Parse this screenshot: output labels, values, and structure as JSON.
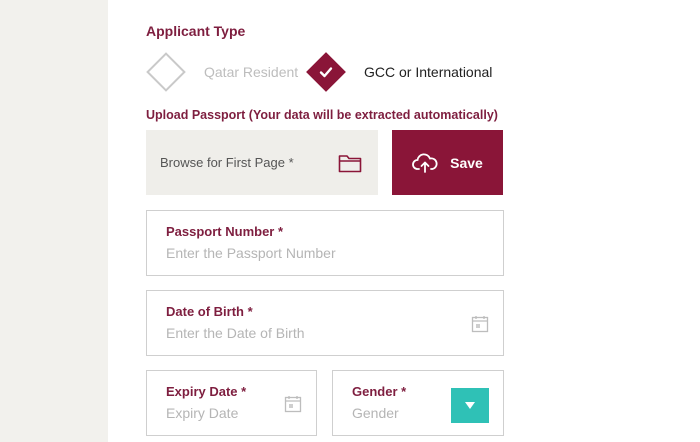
{
  "applicant_type": {
    "title": "Applicant Type",
    "options": [
      {
        "label": "Qatar Resident",
        "selected": false
      },
      {
        "label": "GCC or International",
        "selected": true
      }
    ]
  },
  "upload": {
    "label": "Upload Passport (Your data will be extracted automatically)",
    "browse_text": "Browse for First Page *",
    "save_label": "Save"
  },
  "fields": {
    "passport": {
      "label": "Passport Number *",
      "placeholder": "Enter the Passport Number"
    },
    "dob": {
      "label": "Date of Birth *",
      "placeholder": "Enter the Date of Birth"
    },
    "expiry": {
      "label": "Expiry Date *",
      "placeholder": "Expiry Date"
    },
    "gender": {
      "label": "Gender *",
      "placeholder": "Gender"
    }
  },
  "colors": {
    "brand": "#8a1538",
    "label": "#7e1e3f",
    "accent": "#2fc1b6",
    "panel": "#efeeea"
  },
  "icons": [
    "check-icon",
    "folder-icon",
    "cloud-upload-icon",
    "calendar-icon",
    "triangle-down-icon"
  ]
}
